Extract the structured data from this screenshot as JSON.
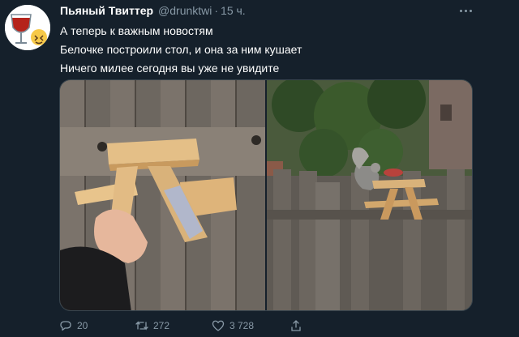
{
  "tweet": {
    "author_name": "Пьяный Твиттер",
    "author_handle": "@drunktwi",
    "separator": "·",
    "time": "15 ч.",
    "lines": [
      "А теперь к важным новостям",
      "Белочке построили стол, и она за ним кушает",
      "Ничего милее сегодня вы уже не увидите"
    ]
  },
  "media": {
    "images": [
      {
        "icon": "picnic-table-in-hand-photo-icon"
      },
      {
        "icon": "squirrel-picnic-table-photo-icon"
      }
    ]
  },
  "actions": {
    "reply_count": "20",
    "retweet_count": "272",
    "like_count": "3 728"
  },
  "colors": {
    "background": "#15202b",
    "text": "#ffffff",
    "secondary": "#8899a6",
    "border": "#38444d"
  }
}
